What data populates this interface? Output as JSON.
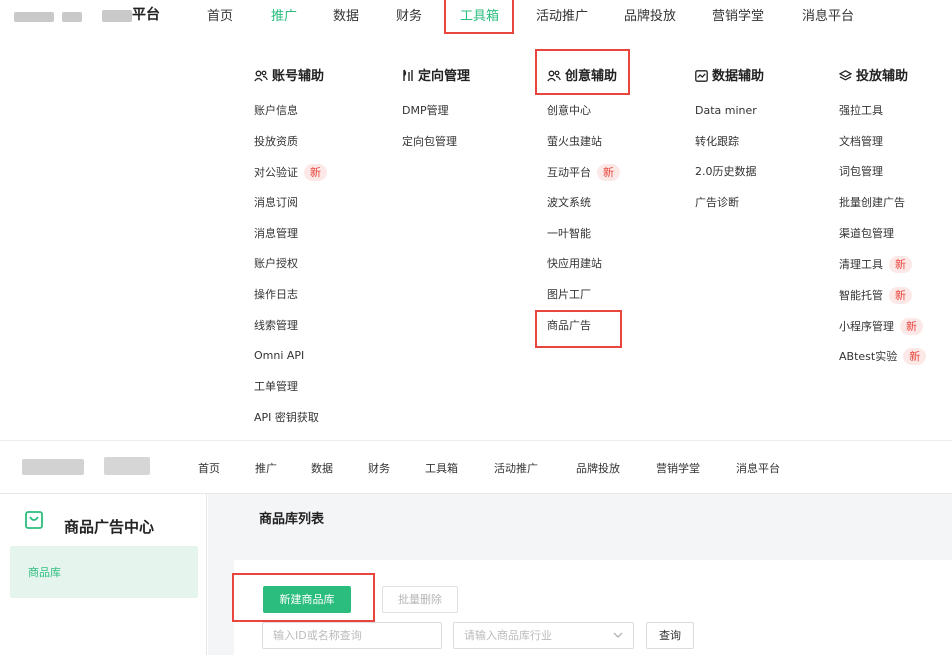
{
  "header": {
    "brand_suffix": "平台",
    "nav": [
      "首页",
      "推广",
      "数据",
      "财务",
      "工具箱",
      "活动推广",
      "品牌投放",
      "营销学堂",
      "消息平台"
    ]
  },
  "mega_menu": {
    "badge": "新",
    "columns": [
      {
        "icon": "users-icon",
        "title": "账号辅助",
        "items": [
          {
            "label": "账户信息"
          },
          {
            "label": "投放资质"
          },
          {
            "label": "对公验证",
            "badge": true
          },
          {
            "label": "消息订阅"
          },
          {
            "label": "消息管理"
          },
          {
            "label": "账户授权"
          },
          {
            "label": "操作日志"
          },
          {
            "label": "线索管理"
          },
          {
            "label": "Omni API"
          },
          {
            "label": "工单管理"
          },
          {
            "label": "API 密钥获取"
          }
        ]
      },
      {
        "icon": "target-icon",
        "title": "定向管理",
        "items": [
          {
            "label": "DMP管理"
          },
          {
            "label": "定向包管理"
          }
        ]
      },
      {
        "icon": "users-icon",
        "title": "创意辅助",
        "items": [
          {
            "label": "创意中心"
          },
          {
            "label": "萤火虫建站"
          },
          {
            "label": "互动平台",
            "badge": true
          },
          {
            "label": "波文系统"
          },
          {
            "label": "一叶智能"
          },
          {
            "label": "快应用建站"
          },
          {
            "label": "图片工厂"
          },
          {
            "label": "商品广告"
          }
        ]
      },
      {
        "icon": "chart-icon",
        "title": "数据辅助",
        "items": [
          {
            "label": "Data miner"
          },
          {
            "label": "转化跟踪"
          },
          {
            "label": "2.0历史数据"
          },
          {
            "label": "广告诊断"
          }
        ]
      },
      {
        "icon": "layers-icon",
        "title": "投放辅助",
        "items": [
          {
            "label": "强拉工具"
          },
          {
            "label": "文档管理"
          },
          {
            "label": "词包管理"
          },
          {
            "label": "批量创建广告"
          },
          {
            "label": "渠道包管理"
          },
          {
            "label": "清理工具",
            "badge": true
          },
          {
            "label": "智能托管",
            "badge": true
          },
          {
            "label": "小程序管理",
            "badge": true
          },
          {
            "label": "ABtest实验",
            "badge": true
          }
        ]
      }
    ]
  },
  "sidebar": {
    "title": "商品广告中心",
    "items": [
      {
        "label": "商品库"
      }
    ]
  },
  "main": {
    "page_title": "商品库列表",
    "create_button": "新建商品库",
    "batch_delete_button": "批量删除",
    "search_placeholder": "输入ID或名称查询",
    "industry_placeholder": "请输入商品库行业",
    "query_button": "查询"
  },
  "colors": {
    "accent": "#2bbd7e",
    "highlight_box": "#e8453c",
    "badge_text": "#e8453c",
    "badge_bg": "#fde8e8"
  }
}
